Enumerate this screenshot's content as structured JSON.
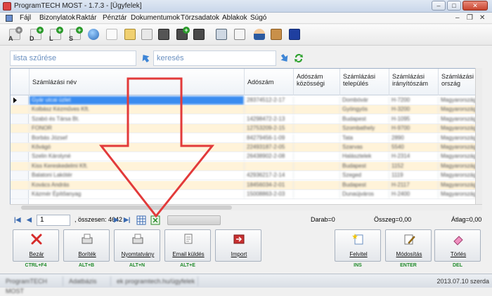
{
  "window": {
    "title": "ProgramTECH MOST - 1.7.3 - [Ügyfelek]",
    "controls": {
      "minimize": "–",
      "maximize": "□",
      "close": "✕"
    },
    "mdi_controls": {
      "minimize": "–",
      "restore": "❐",
      "close": "✕"
    }
  },
  "menu": [
    "Fájl",
    "Bizonylatok",
    "Raktár",
    "Pénztár",
    "Dokumentumok",
    "Törzsadatok",
    "Ablakok",
    "Súgó"
  ],
  "toolbar": {
    "letters": [
      "A",
      "D",
      "L",
      "S"
    ],
    "plus": "+"
  },
  "filter": {
    "list_filter_placeholder": "lista szűrése",
    "search_placeholder": "keresés"
  },
  "grid": {
    "columns": [
      "Számlázási név",
      "Adószám",
      "Adószám közösségi",
      "Számlázási település",
      "Számlázási irányítószám",
      "Számlázási ország"
    ],
    "rows": [
      [
        "Gyár utcai üzlet",
        "28374512-2-17",
        "",
        "Dombóvár",
        "H-7200",
        "Magyarország"
      ],
      [
        "Kolbász Kézműves Kft.",
        "",
        "",
        "Gyöngyös",
        "H-3200",
        "Magyarország"
      ],
      [
        "Szabó és Társa Bt.",
        "14298472-2-13",
        "",
        "Budapest",
        "H-1095",
        "Magyarország"
      ],
      [
        "FONOR",
        "12753209-2-15",
        "",
        "Szombathely",
        "H-9700",
        "Magyarország"
      ],
      [
        "Borbás József",
        "84279456-1-09",
        "",
        "Tata",
        "2890",
        "Magyarország"
      ],
      [
        "Kővágó",
        "22493187-2-05",
        "",
        "Szarvas",
        "5540",
        "Magyarország"
      ],
      [
        "Szelin Károlyné",
        "26438902-2-08",
        "",
        "Halásztelek",
        "H-2314",
        "Magyarország"
      ],
      [
        "Kiss Kereskedelmi Kft.",
        "",
        "",
        "Budapest",
        "1152",
        "Magyarország"
      ],
      [
        "Balatoni Lakótér",
        "42936217-2-14",
        "",
        "Szeged",
        "1119",
        "Magyarország"
      ],
      [
        "Kovács András",
        "18456034-2-01",
        "",
        "Budapest",
        "H-2117",
        "Magyarország"
      ],
      [
        "Kázmér Építőanyag",
        "15008863-2-03",
        "",
        "Dunaújváros",
        "H-2400",
        "Magyarország"
      ]
    ]
  },
  "pager": {
    "first": "|◀",
    "prev": "◀",
    "page": "1",
    "total_label": ", összesen: 4642",
    "next": "▶",
    "last": "▶|",
    "darab": "Darab=0",
    "osszeg": "Összeg=0,00",
    "atlag": "Átlag=0,00"
  },
  "buttons": [
    {
      "label": "Bezár",
      "shortcut": "CTRL+F4"
    },
    {
      "label": "Boríték",
      "shortcut": "ALT+B"
    },
    {
      "label": "Nyomtatvány",
      "shortcut": "ALT+N"
    },
    {
      "label": "Email küldés",
      "shortcut": "ALT+E"
    },
    {
      "label": "Import",
      "shortcut": ""
    },
    {
      "label": "Felvitel",
      "shortcut": "INS"
    },
    {
      "label": "Módosítás",
      "shortcut": "ENTER"
    },
    {
      "label": "Törlés",
      "shortcut": "DEL"
    }
  ],
  "status": {
    "user": "ProgramTECH MOST",
    "db": "Adatbázis",
    "path": "ek programtech.hu/ügyfelek",
    "date": "2013.07.10 szerda"
  },
  "colors": {
    "accent": "#3a8cf0",
    "row_alt": "#fff3d9",
    "shortcut": "#1f8a2a",
    "annotation_arrow": "#e23a3a"
  }
}
